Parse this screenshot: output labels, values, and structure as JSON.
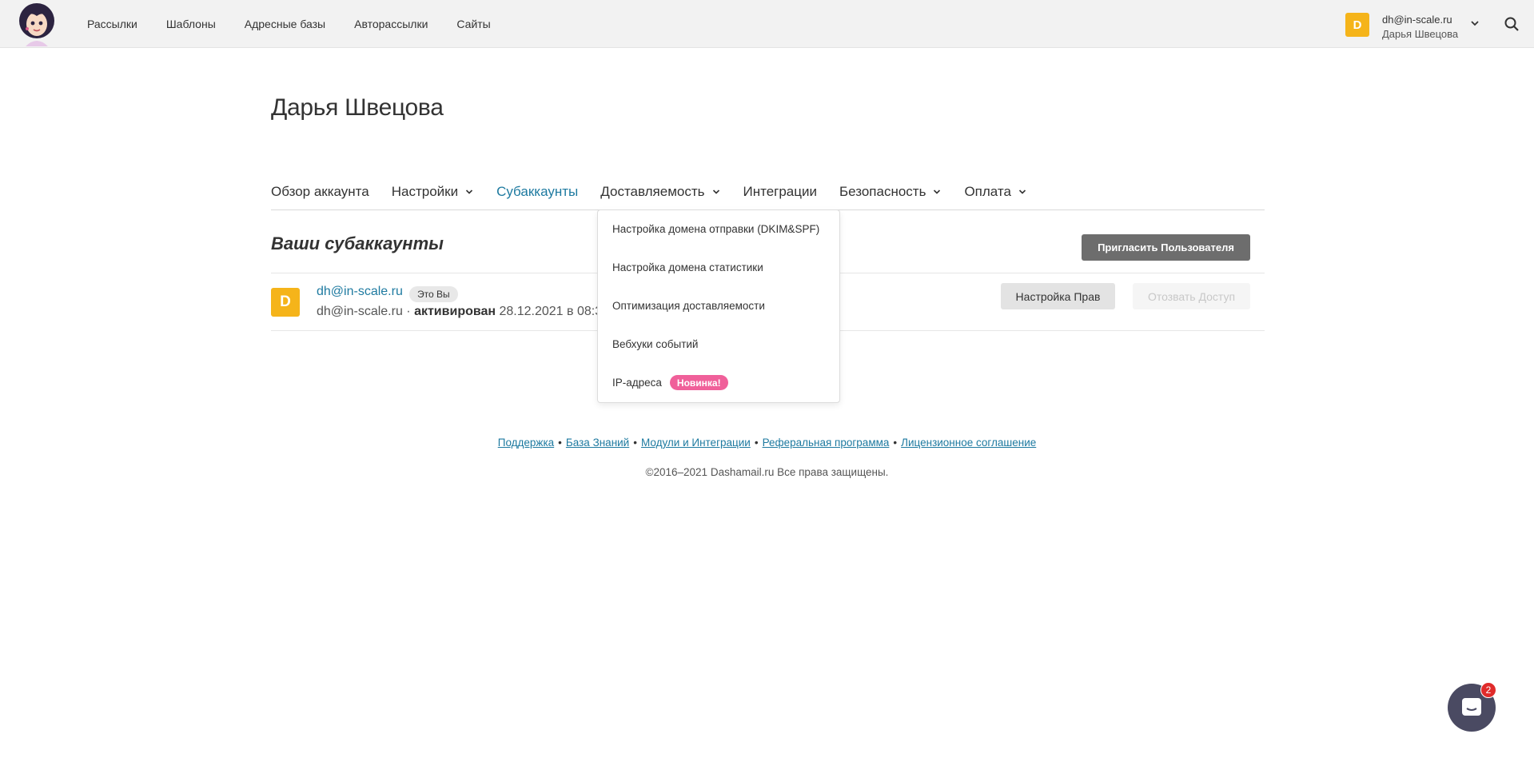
{
  "topnav": {
    "items": [
      "Рассылки",
      "Шаблоны",
      "Адресные базы",
      "Авторассылки",
      "Сайты"
    ]
  },
  "user": {
    "avatar_letter": "D",
    "email": "dh@in-scale.ru",
    "name": "Дарья Швецова"
  },
  "page": {
    "title": "Дарья Швецова"
  },
  "tabs": [
    {
      "label": "Обзор аккаунта"
    },
    {
      "label": "Настройки"
    },
    {
      "label": "Субаккаунты"
    },
    {
      "label": "Доставляемость"
    },
    {
      "label": "Интеграции"
    },
    {
      "label": "Безопасность"
    },
    {
      "label": "Оплата"
    }
  ],
  "subaccounts": {
    "title": "Ваши субаккаунты",
    "invite_label": "Пригласить Пользователя",
    "rows": [
      {
        "avatar_letter": "D",
        "email": "dh@in-scale.ru",
        "you_badge": "Это Вы",
        "login": "dh@in-scale.ru",
        "separator": " · ",
        "status": "активирован",
        "date": " 28.12.2021 в 08:37",
        "rights_label": "Настройка Прав",
        "revoke_label": "Отозвать Доступ"
      }
    ]
  },
  "dropdown": {
    "items": [
      "Настройка домена отправки (DKIM&SPF)",
      "Настройка домена статистики",
      "Оптимизация доставляемости",
      "Вебхуки событий",
      "IP-адреса"
    ],
    "new_badge": "Новинка!"
  },
  "footer": {
    "links": [
      "Поддержка",
      "База Знаний",
      "Модули и Интеграции",
      "Реферальная программа",
      "Лицензионное соглашение"
    ],
    "separator": "•",
    "copyright": "©2016–2021 Dashamail.ru Все права защищены."
  },
  "chat": {
    "unread": "2"
  },
  "colors": {
    "accent": "#1e7aa0",
    "avatar": "#f5b41a",
    "badge_new": "#f0609a",
    "chat": "#4a4a62"
  }
}
